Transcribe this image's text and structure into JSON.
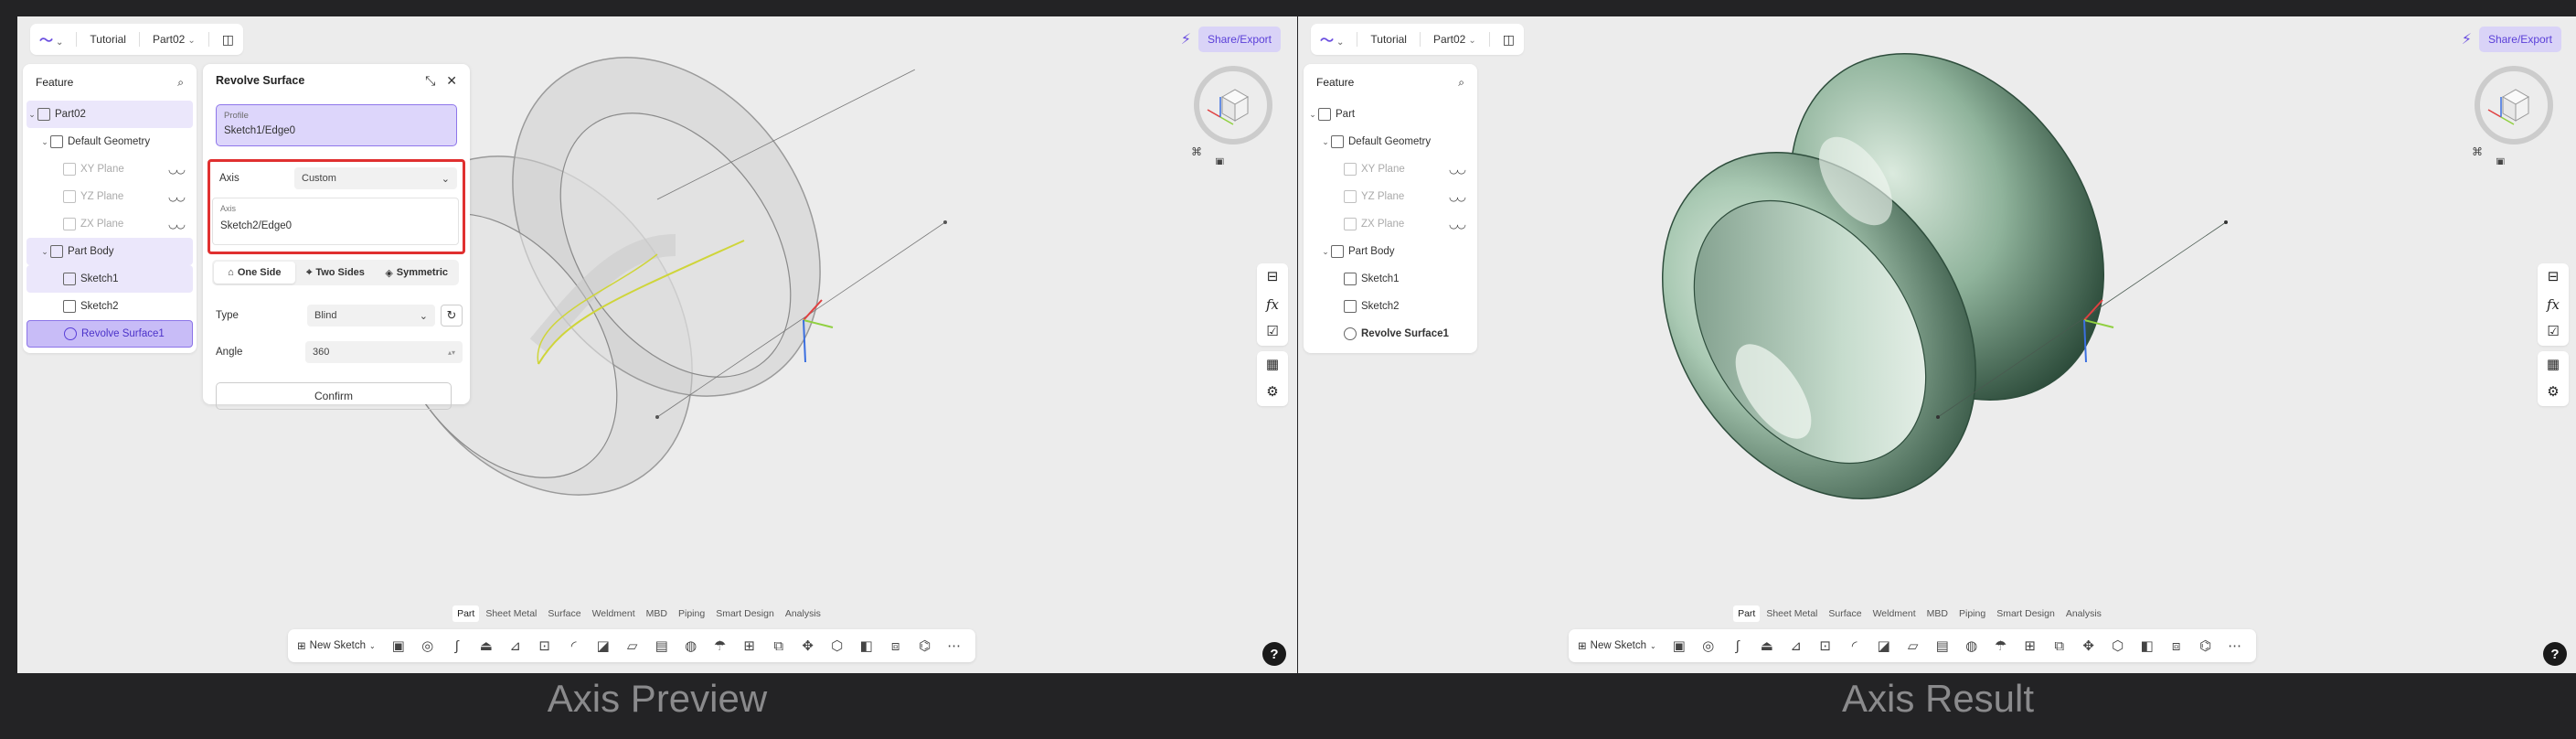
{
  "colors": {
    "accent": "#7b5ce6",
    "highlight_box": "#e03030",
    "selected_bg": "#c8bcf7"
  },
  "panels": [
    {
      "id": "preview",
      "topbar": {
        "app_icon": "logo-icon",
        "tutorial": "Tutorial",
        "part": "Part02"
      },
      "share": "Share/Export",
      "tree": {
        "header": "Feature",
        "items": [
          {
            "label": "Part02",
            "icon": "part-icon"
          },
          {
            "label": "Default Geometry",
            "icon": "geometry-icon"
          },
          {
            "label": "XY Plane",
            "icon": "plane-icon"
          },
          {
            "label": "YZ Plane",
            "icon": "plane-icon"
          },
          {
            "label": "ZX Plane",
            "icon": "plane-icon"
          },
          {
            "label": "Part Body",
            "icon": "body-icon"
          },
          {
            "label": "Sketch1",
            "icon": "sketch-icon"
          },
          {
            "label": "Sketch2",
            "icon": "sketch-icon"
          },
          {
            "label": "Revolve Surface1",
            "icon": "revolve-icon"
          }
        ]
      },
      "dialog": {
        "title": "Revolve Surface",
        "profile_label": "Profile",
        "profile_value": "Sketch1/Edge0",
        "axis_label": "Axis",
        "axis_value": "Custom",
        "axis_sub_label": "Axis",
        "axis_sub_value": "Sketch2/Edge0",
        "modes": [
          "One Side",
          "Two Sides",
          "Symmetric"
        ],
        "type_label": "Type",
        "type_value": "Blind",
        "angle_label": "Angle",
        "angle_value": "360",
        "confirm": "Confirm"
      }
    },
    {
      "id": "result",
      "topbar": {
        "app_icon": "logo-icon",
        "tutorial": "Tutorial",
        "part": "Part02"
      },
      "share": "Share/Export",
      "tree": {
        "header": "Feature",
        "items": [
          {
            "label": "Part",
            "icon": "part-icon"
          },
          {
            "label": "Default Geometry",
            "icon": "geometry-icon"
          },
          {
            "label": "XY Plane",
            "icon": "plane-icon"
          },
          {
            "label": "YZ Plane",
            "icon": "plane-icon"
          },
          {
            "label": "ZX Plane",
            "icon": "plane-icon"
          },
          {
            "label": "Part Body",
            "icon": "body-icon"
          },
          {
            "label": "Sketch1",
            "icon": "sketch-icon"
          },
          {
            "label": "Sketch2",
            "icon": "sketch-icon"
          },
          {
            "label": "Revolve Surface1",
            "icon": "revolve-icon"
          }
        ]
      }
    }
  ],
  "tabs": [
    "Part",
    "Sheet Metal",
    "Surface",
    "Weldment",
    "MBD",
    "Piping",
    "Smart Design",
    "Analysis"
  ],
  "new_sketch": "New Sketch",
  "captions": [
    "Axis Preview",
    "Axis Result"
  ]
}
